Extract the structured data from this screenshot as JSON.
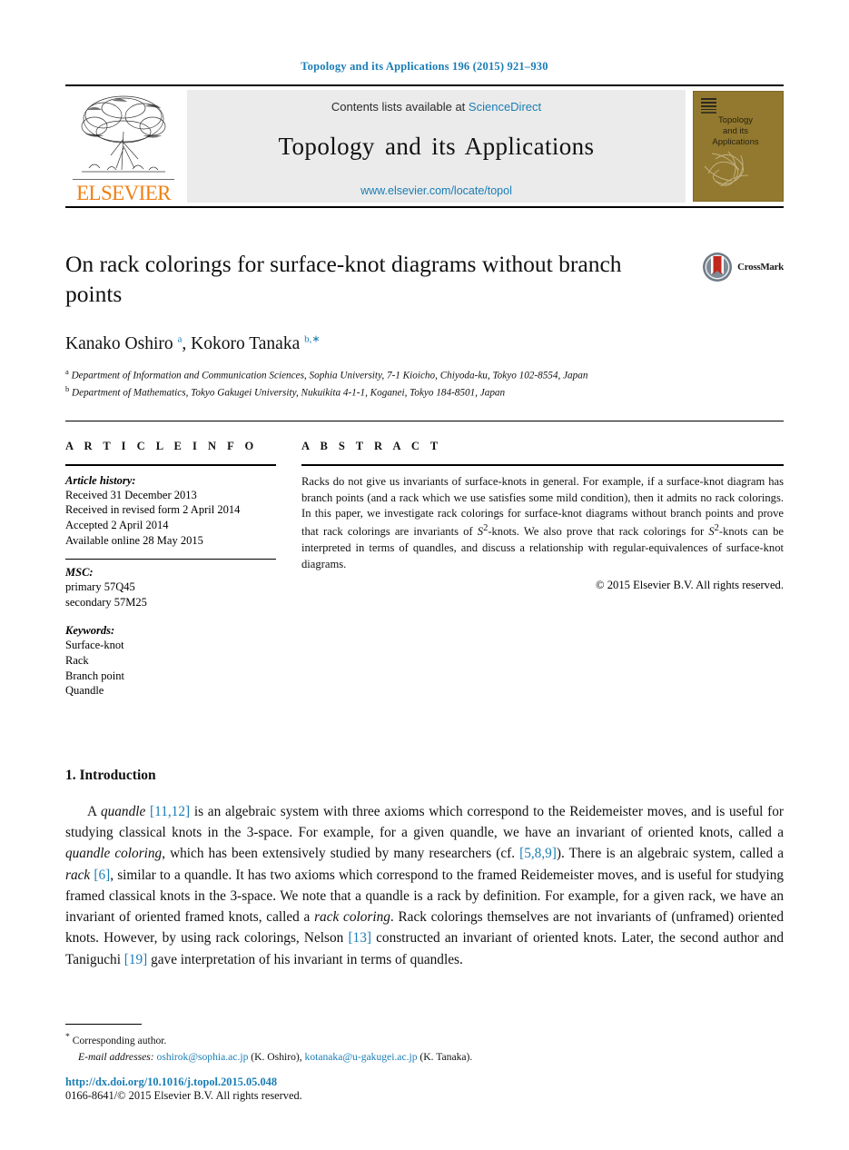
{
  "running_head": "Topology and its Applications 196 (2015) 921–930",
  "masthead": {
    "publisher_name": "ELSEVIER",
    "contents_prefix": "Contents lists available at",
    "sciencedirect": "ScienceDirect",
    "journal_title": "Topology and its Applications",
    "journal_url": "www.elsevier.com/locate/topol",
    "cover_title_line1": "Topology",
    "cover_title_line2": "and its",
    "cover_title_line3": "Applications",
    "link_color": "#1a7db5",
    "cover_color": "#92792f",
    "band_color": "#ebebeb",
    "elsevier_orange": "#f07f13"
  },
  "article": {
    "title": "On rack colorings for surface-knot diagrams without branch points",
    "crossmark_label": "CrossMark",
    "authors_html": "Kanako Oshiro <sup>a</sup>, Kokoro Tanaka <sup>b,∗</sup>",
    "affiliations": [
      {
        "marker": "a",
        "text": "Department of Information and Communication Sciences, Sophia University, 7-1 Kioicho, Chiyoda-ku, Tokyo 102-8554, Japan"
      },
      {
        "marker": "b",
        "text": "Department of Mathematics, Tokyo Gakugei University, Nukuikita 4-1-1, Koganei, Tokyo 184-8501, Japan"
      }
    ]
  },
  "article_info": {
    "heading": "A R T I C L E    I N F O",
    "history_label": "Article history:",
    "history": [
      "Received 31 December 2013",
      "Received in revised form 2 April 2014",
      "Accepted 2 April 2014",
      "Available online 28 May 2015"
    ],
    "msc_label": "MSC:",
    "msc": [
      "primary 57Q45",
      "secondary 57M25"
    ],
    "keywords_label": "Keywords:",
    "keywords": [
      "Surface-knot",
      "Rack",
      "Branch point",
      "Quandle"
    ]
  },
  "abstract": {
    "heading": "A B S T R A C T",
    "text_html": "Racks do not give us invariants of surface-knots in general. For example, if a surface-knot diagram has branch points (and a rack which we use satisfies some mild condition), then it admits no rack colorings. In this paper, we investigate rack colorings for surface-knot diagrams without branch points and prove that rack colorings are invariants of <i>S</i><sup>2</sup>-knots. We also prove that rack colorings for <i>S</i><sup>2</sup>-knots can be interpreted in terms of quandles, and discuss a relationship with regular-equivalences of surface-knot diagrams.",
    "copyright": "© 2015 Elsevier B.V. All rights reserved."
  },
  "body": {
    "section_number_title": "1. Introduction",
    "paragraph_html": "A <i>quandle</i> <span class=\"cite\">[11,12]</span> is an algebraic system with three axioms which correspond to the Reidemeister moves, and is useful for studying classical knots in the 3-space. For example, for a given quandle, we have an invariant of oriented knots, called a <i>quandle coloring</i>, which has been extensively studied by many researchers (cf. <span class=\"cite\">[5,8,9]</span>). There is an algebraic system, called a <i>rack</i> <span class=\"cite\">[6]</span>, similar to a quandle. It has two axioms which correspond to the framed Reidemeister moves, and is useful for studying framed classical knots in the 3-space. We note that a quandle is a rack by definition. For example, for a given rack, we have an invariant of oriented framed knots, called a <i>rack coloring</i>. Rack colorings themselves are not invariants of (unframed) oriented knots. However, by using rack colorings, Nelson <span class=\"cite\">[13]</span> constructed an invariant of oriented knots. Later, the second author and Taniguchi <span class=\"cite\">[19]</span> gave interpretation of his invariant in terms of quandles."
  },
  "footnotes": {
    "corresponding_marker": "*",
    "corresponding_text": "Corresponding author.",
    "email_label": "E-mail addresses:",
    "email_html": "<span class=\"link\">oshirok@sophia.ac.jp</span> (K. Oshiro), <span class=\"link\">kotanaka@u-gakugei.ac.jp</span> (K. Tanaka).",
    "doi": "http://dx.doi.org/10.1016/j.topol.2015.05.048",
    "issn_line": "0166-8641/© 2015 Elsevier B.V. All rights reserved."
  }
}
